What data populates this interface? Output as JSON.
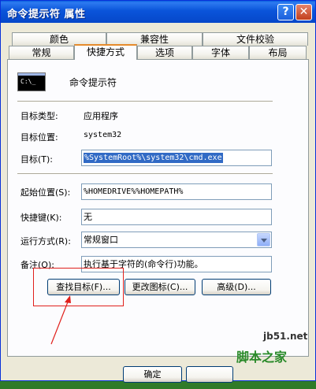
{
  "window": {
    "title": "命令提示符 属性",
    "help_button": "?",
    "close_button": "✕"
  },
  "tabs_back": [
    "颜色",
    "兼容性",
    "文件校验"
  ],
  "tabs_front": [
    "常规",
    "快捷方式",
    "选项",
    "字体",
    "布局"
  ],
  "active_tab": "快捷方式",
  "shortcut": {
    "name": "命令提示符",
    "icon_text": "C:\\_",
    "target_type_label": "目标类型:",
    "target_type_value": "应用程序",
    "target_location_label": "目标位置:",
    "target_location_value": "system32",
    "target_label": "目标(T):",
    "target_value": "%SystemRoot%\\system32\\cmd.exe",
    "start_in_label": "起始位置(S):",
    "start_in_value": "%HOMEDRIVE%%HOMEPATH%",
    "hotkey_label": "快捷键(K):",
    "hotkey_value": "无",
    "run_label": "运行方式(R):",
    "run_value": "常规窗口",
    "comment_label": "备注(O):",
    "comment_value": "执行基于字符的(命令行)功能。",
    "find_target_button": "查找目标(F)...",
    "change_icon_button": "更改图标(C)...",
    "advanced_button": "高级(D)..."
  },
  "footer": {
    "ok_button": "确定"
  },
  "watermark": {
    "line1": "jb51.net",
    "line2": "脚本之家"
  },
  "colors": {
    "titlebar": "#0a54da",
    "selection": "#316ac5",
    "annotation_red": "#e0201c"
  }
}
